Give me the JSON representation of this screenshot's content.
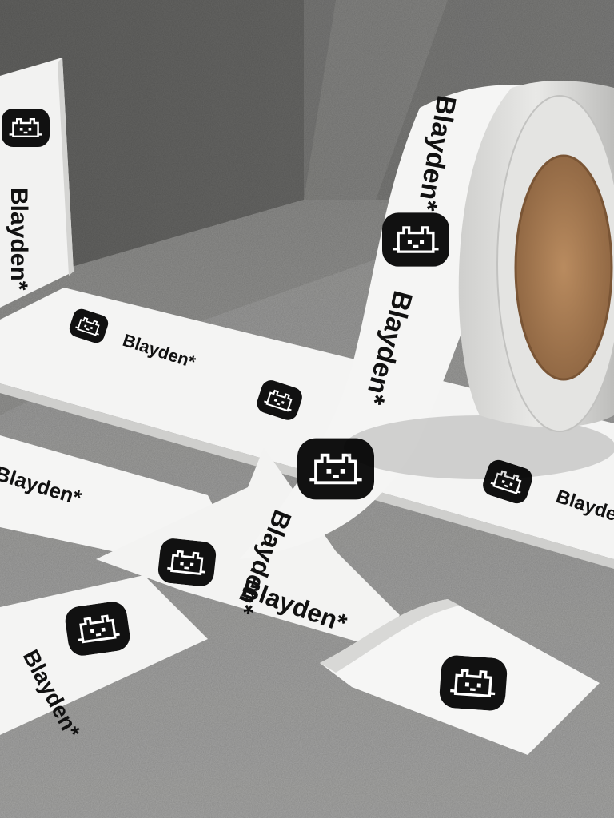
{
  "brand": {
    "wordmark": "Blayden*"
  },
  "colors": {
    "tape": "#f4f4f3",
    "tape_shade": "#d6d6d4",
    "ink": "#111111",
    "concrete_floor": "#9c9c9a",
    "concrete_wall": "#6f6f6d",
    "cardboard_core": "#a57a52"
  },
  "icons": [
    "pixel-cat-logo-icon"
  ]
}
